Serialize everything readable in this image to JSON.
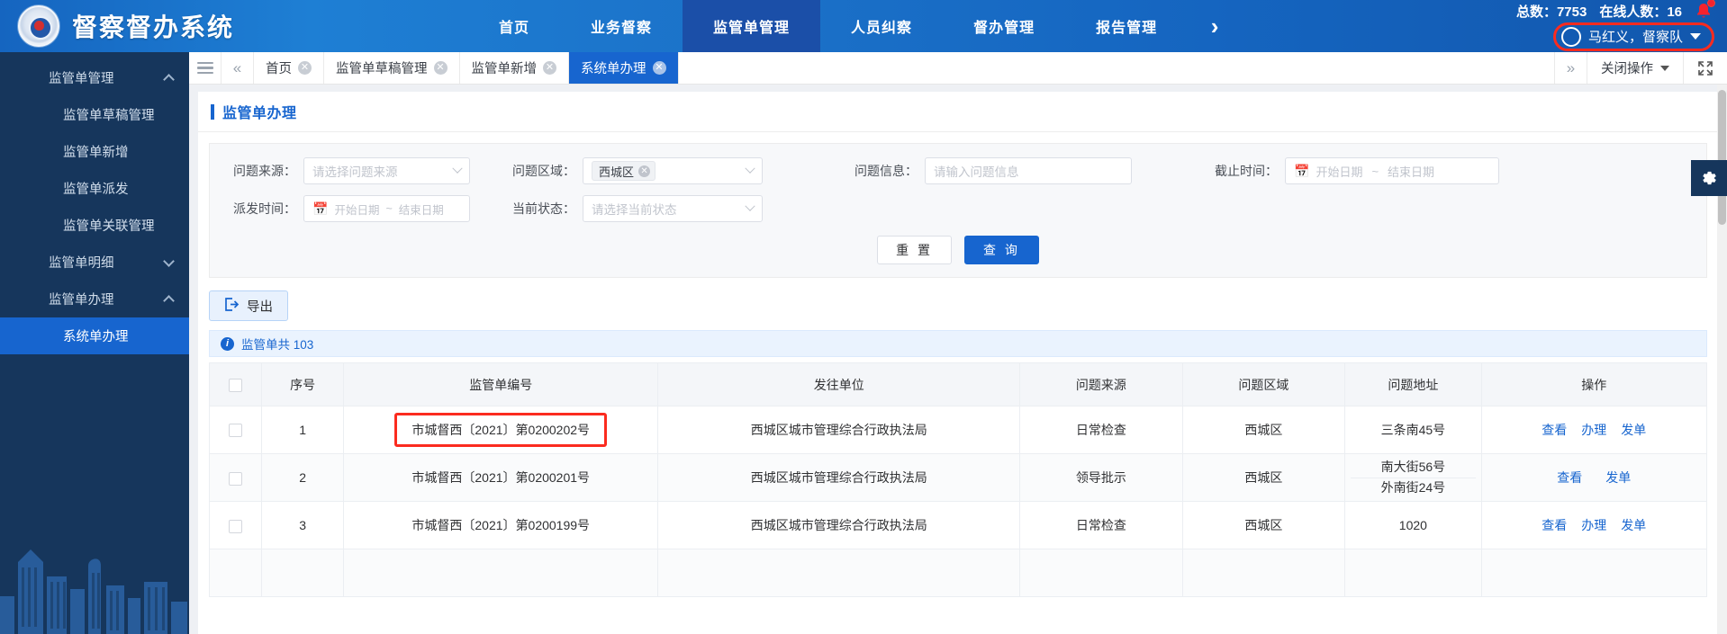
{
  "header": {
    "brand_title": "督察督办系统",
    "emblem_icon": "police-emblem-icon",
    "nav": [
      {
        "label": "首页",
        "active": false
      },
      {
        "label": "业务督察",
        "active": false
      },
      {
        "label": "监管单管理",
        "active": true
      },
      {
        "label": "人员纠察",
        "active": false
      },
      {
        "label": "督办管理",
        "active": false
      },
      {
        "label": "报告管理",
        "active": false
      }
    ],
    "nav_more_icon": "chevron-right-icon",
    "stats": {
      "total_label": "总数：7753",
      "online_label": "在线人数：16",
      "bell_icon": "bell-icon"
    },
    "user": {
      "name": "马红义，督察队",
      "avatar_icon": "avatar-icon",
      "caret_icon": "chevron-down-icon",
      "highlight_color": "#fb2b1f"
    }
  },
  "sidebar": {
    "items": [
      {
        "label": "监管单管理",
        "level": "group",
        "active": false,
        "chevron": "chevron-up-icon"
      },
      {
        "label": "监管单草稿管理",
        "level": "child",
        "active": false,
        "chevron": ""
      },
      {
        "label": "监管单新增",
        "level": "child",
        "active": false,
        "chevron": ""
      },
      {
        "label": "监管单派发",
        "level": "child",
        "active": false,
        "chevron": ""
      },
      {
        "label": "监管单关联管理",
        "level": "child",
        "active": false,
        "chevron": ""
      },
      {
        "label": "监管单明细",
        "level": "group",
        "active": false,
        "chevron": "chevron-down-icon"
      },
      {
        "label": "监管单办理",
        "level": "group",
        "active": false,
        "chevron": "chevron-up-icon"
      },
      {
        "label": "系统单办理",
        "level": "child",
        "active": true,
        "chevron": ""
      }
    ]
  },
  "tabbar": {
    "menu_icon": "hamburger-icon",
    "scroll_left_icon": "double-chevron-left-icon",
    "scroll_right_icon": "double-chevron-right-icon",
    "tabs": [
      {
        "label": "首页",
        "active": false
      },
      {
        "label": "监管单草稿管理",
        "active": false
      },
      {
        "label": "监管单新增",
        "active": false
      },
      {
        "label": "系统单办理",
        "active": true
      }
    ],
    "close_ops_label": "关闭操作",
    "fullscreen_icon": "fullscreen-icon"
  },
  "page": {
    "title": "监管单办理",
    "gear_icon": "gear-icon"
  },
  "search": {
    "fields": {
      "problem_source": {
        "label": "问题来源：",
        "placeholder": "请选择问题来源",
        "value": ""
      },
      "problem_area": {
        "label": "问题区域：",
        "placeholder": "",
        "value": "西城区"
      },
      "problem_info": {
        "label": "问题信息：",
        "placeholder": "请输入问题信息",
        "value": ""
      },
      "deadline": {
        "label": "截止时间：",
        "start_placeholder": "开始日期",
        "end_placeholder": "结束日期",
        "separator": "~"
      },
      "dispatch_time": {
        "label": "派发时间：",
        "start_placeholder": "开始日期",
        "end_placeholder": "结束日期",
        "separator": "~"
      },
      "current_status": {
        "label": "当前状态：",
        "placeholder": "请选择当前状态",
        "value": ""
      }
    },
    "reset_label": "重 置",
    "query_label": "查 询"
  },
  "toolbar": {
    "export_label": "导出",
    "export_icon": "export-icon"
  },
  "infobar": {
    "icon": "info-icon",
    "text": "监管单共 103"
  },
  "table": {
    "columns": [
      "序号",
      "监管单编号",
      "发往单位",
      "问题来源",
      "问题区域",
      "问题地址",
      "操作"
    ],
    "select_all": "",
    "rows": [
      {
        "index": "1",
        "code": "市城督西〔2021〕第0200202号",
        "code_highlighted": true,
        "unit": "西城区城市管理综合行政执法局",
        "source": "日常检查",
        "area": "西城区",
        "address": [
          "三条南45号"
        ],
        "ops": [
          "查看",
          "办理",
          "发单"
        ]
      },
      {
        "index": "2",
        "code": "市城督西〔2021〕第0200201号",
        "code_highlighted": false,
        "unit": "西城区城市管理综合行政执法局",
        "source": "领导批示",
        "area": "西城区",
        "address": [
          "南大街56号",
          "外南街24号"
        ],
        "ops": [
          "查看",
          "发单"
        ]
      },
      {
        "index": "3",
        "code": "市城督西〔2021〕第0200199号",
        "code_highlighted": false,
        "unit": "西城区城市管理综合行政执法局",
        "source": "日常检查",
        "area": "西城区",
        "address": [
          "1020"
        ],
        "ops": [
          "查看",
          "办理",
          "发单"
        ]
      }
    ]
  },
  "colors": {
    "brand_blue": "#1765cf",
    "sidebar_navy": "#16365c",
    "highlight_red": "#fb2b1f",
    "link_blue": "#1765cf"
  }
}
